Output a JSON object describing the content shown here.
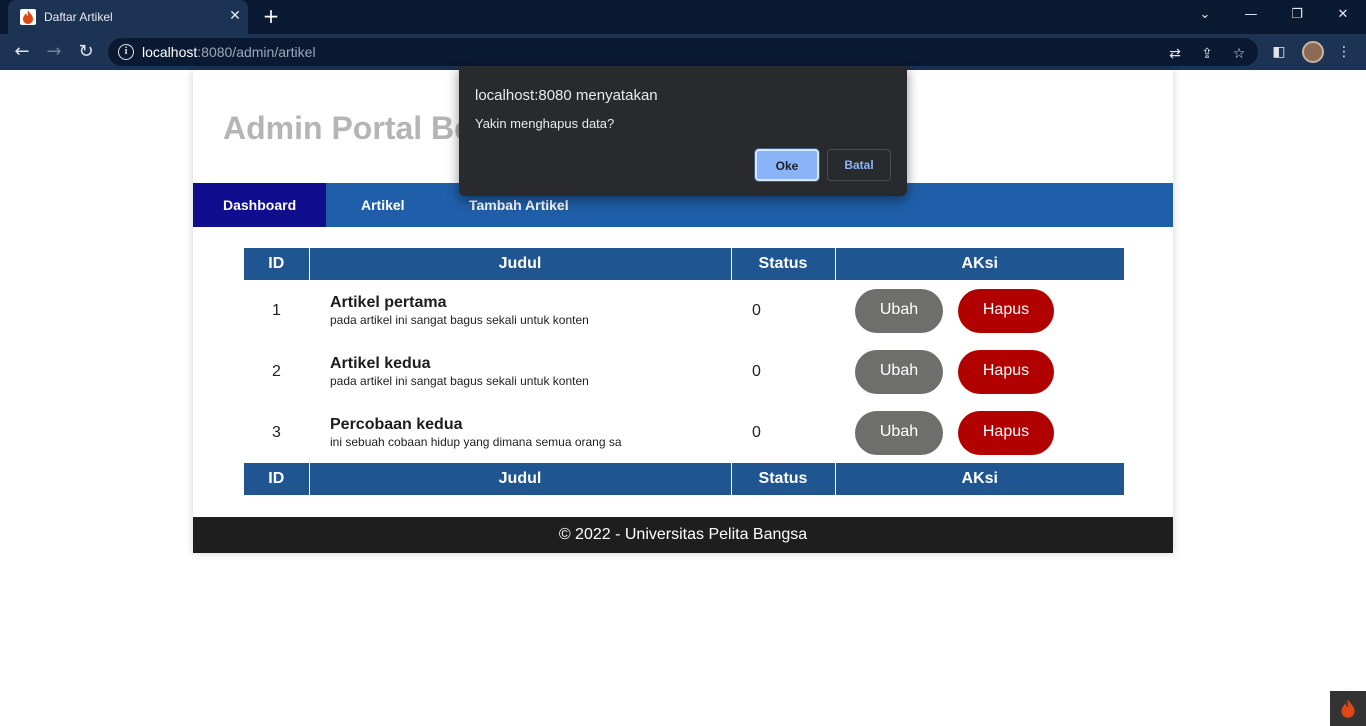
{
  "browser": {
    "tab_title": "Daftar Artikel",
    "tab_close": "✕",
    "new_tab": "+",
    "url_host": "localhost",
    "url_rest": ":8080/admin/artikel",
    "window_controls": {
      "dropdown": "⌄",
      "minimize": "—",
      "restore": "❐",
      "close": "✕"
    },
    "nav": {
      "back": "←",
      "forward": "→",
      "reload": "↻"
    },
    "omnibox_icons": {
      "translate": "⇄",
      "share": "⇪",
      "bookmark": "☆"
    },
    "toolbar_icons": {
      "sidepanel": "◧",
      "menu": "⋮"
    }
  },
  "page": {
    "site_title": "Admin Portal Berita",
    "nav_items": [
      {
        "label": "Dashboard",
        "active": true
      },
      {
        "label": "Artikel",
        "active": false
      },
      {
        "label": "Tambah Artikel",
        "active": false
      }
    ],
    "table": {
      "headers": [
        "ID",
        "Judul",
        "Status",
        "AKsi"
      ],
      "rows": [
        {
          "id": "1",
          "title": "Artikel pertama",
          "desc": "pada artikel ini sangat bagus sekali untuk konten",
          "status": "0",
          "edit": "Ubah",
          "delete": "Hapus"
        },
        {
          "id": "2",
          "title": "Artikel kedua",
          "desc": "pada artikel ini sangat bagus sekali untuk konten",
          "status": "0",
          "edit": "Ubah",
          "delete": "Hapus"
        },
        {
          "id": "3",
          "title": "Percobaan kedua",
          "desc": "ini sebuah cobaan hidup yang dimana semua orang sa",
          "status": "0",
          "edit": "Ubah",
          "delete": "Hapus"
        }
      ]
    },
    "footer": "© 2022 - Universitas Pelita Bangsa"
  },
  "dialog": {
    "title": "localhost:8080 menyatakan",
    "message": "Yakin menghapus data?",
    "ok_label": "Oke",
    "cancel_label": "Batal"
  },
  "colors": {
    "nav_bg": "#1f5fa9",
    "nav_active": "#0e0e8f",
    "table_header": "#1f5691",
    "edit_button": "#6e6f6d",
    "delete_button": "#b10000",
    "footer_bg": "#1e1e1e",
    "dialog_bg": "#292a2d",
    "dialog_accent": "#8ab4f8"
  }
}
